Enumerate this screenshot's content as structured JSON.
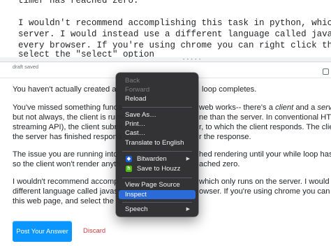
{
  "editor": {
    "lines": [
      "timer has reached zero.",
      "",
      "I wouldn't recommend accomplishing this task in python, which only runs on",
      "server. I would instead use a different language called javascript which r",
      "every browser. If you're using chrome you can right click this web page, an",
      "select the \"select\" option"
    ]
  },
  "status": {
    "draft": "draft saved"
  },
  "preview": {
    "p1": "You haven't actually created a",
    "p1b": "loop completes.",
    "p2a": "You've missed something funda",
    "p2b": "web works-- there's a",
    "p2c": "client",
    "p2d": "and a",
    "p2e": "serve",
    "p3a": "but not always, the client is runn",
    "p3b": "ne than the server. In conventional HTTP",
    "p4a": "streaming API), the client submi",
    "p4b": "r, to which the client responds. The clien",
    "p5a": "the server has finished respond",
    "p5b": "r the response.",
    "p6a": "The issue you are running into",
    "p6b": "hed rendering until your while loop has c",
    "p7a": "so the client won't render anyth",
    "p7b": "ached zero.",
    "p8a": "I wouldn't recommend accomp",
    "p8b": "which only runs on the server. I would in",
    "p9a": "different language called javasc",
    "p9b": "owser. If you're using chrome you can ri",
    "p10a": "this web page, and select the \"s"
  },
  "actions": {
    "post": "Post Your Answer",
    "discard": "Discard"
  },
  "context_menu": {
    "back": "Back",
    "forward": "Forward",
    "reload": "Reload",
    "save_as": "Save As…",
    "print": "Print…",
    "cast": "Cast…",
    "translate": "Translate to English",
    "bitwarden": "Bitwarden",
    "houzz": "Save to Houzz",
    "view_source": "View Page Source",
    "inspect": "Inspect",
    "speech": "Speech"
  }
}
